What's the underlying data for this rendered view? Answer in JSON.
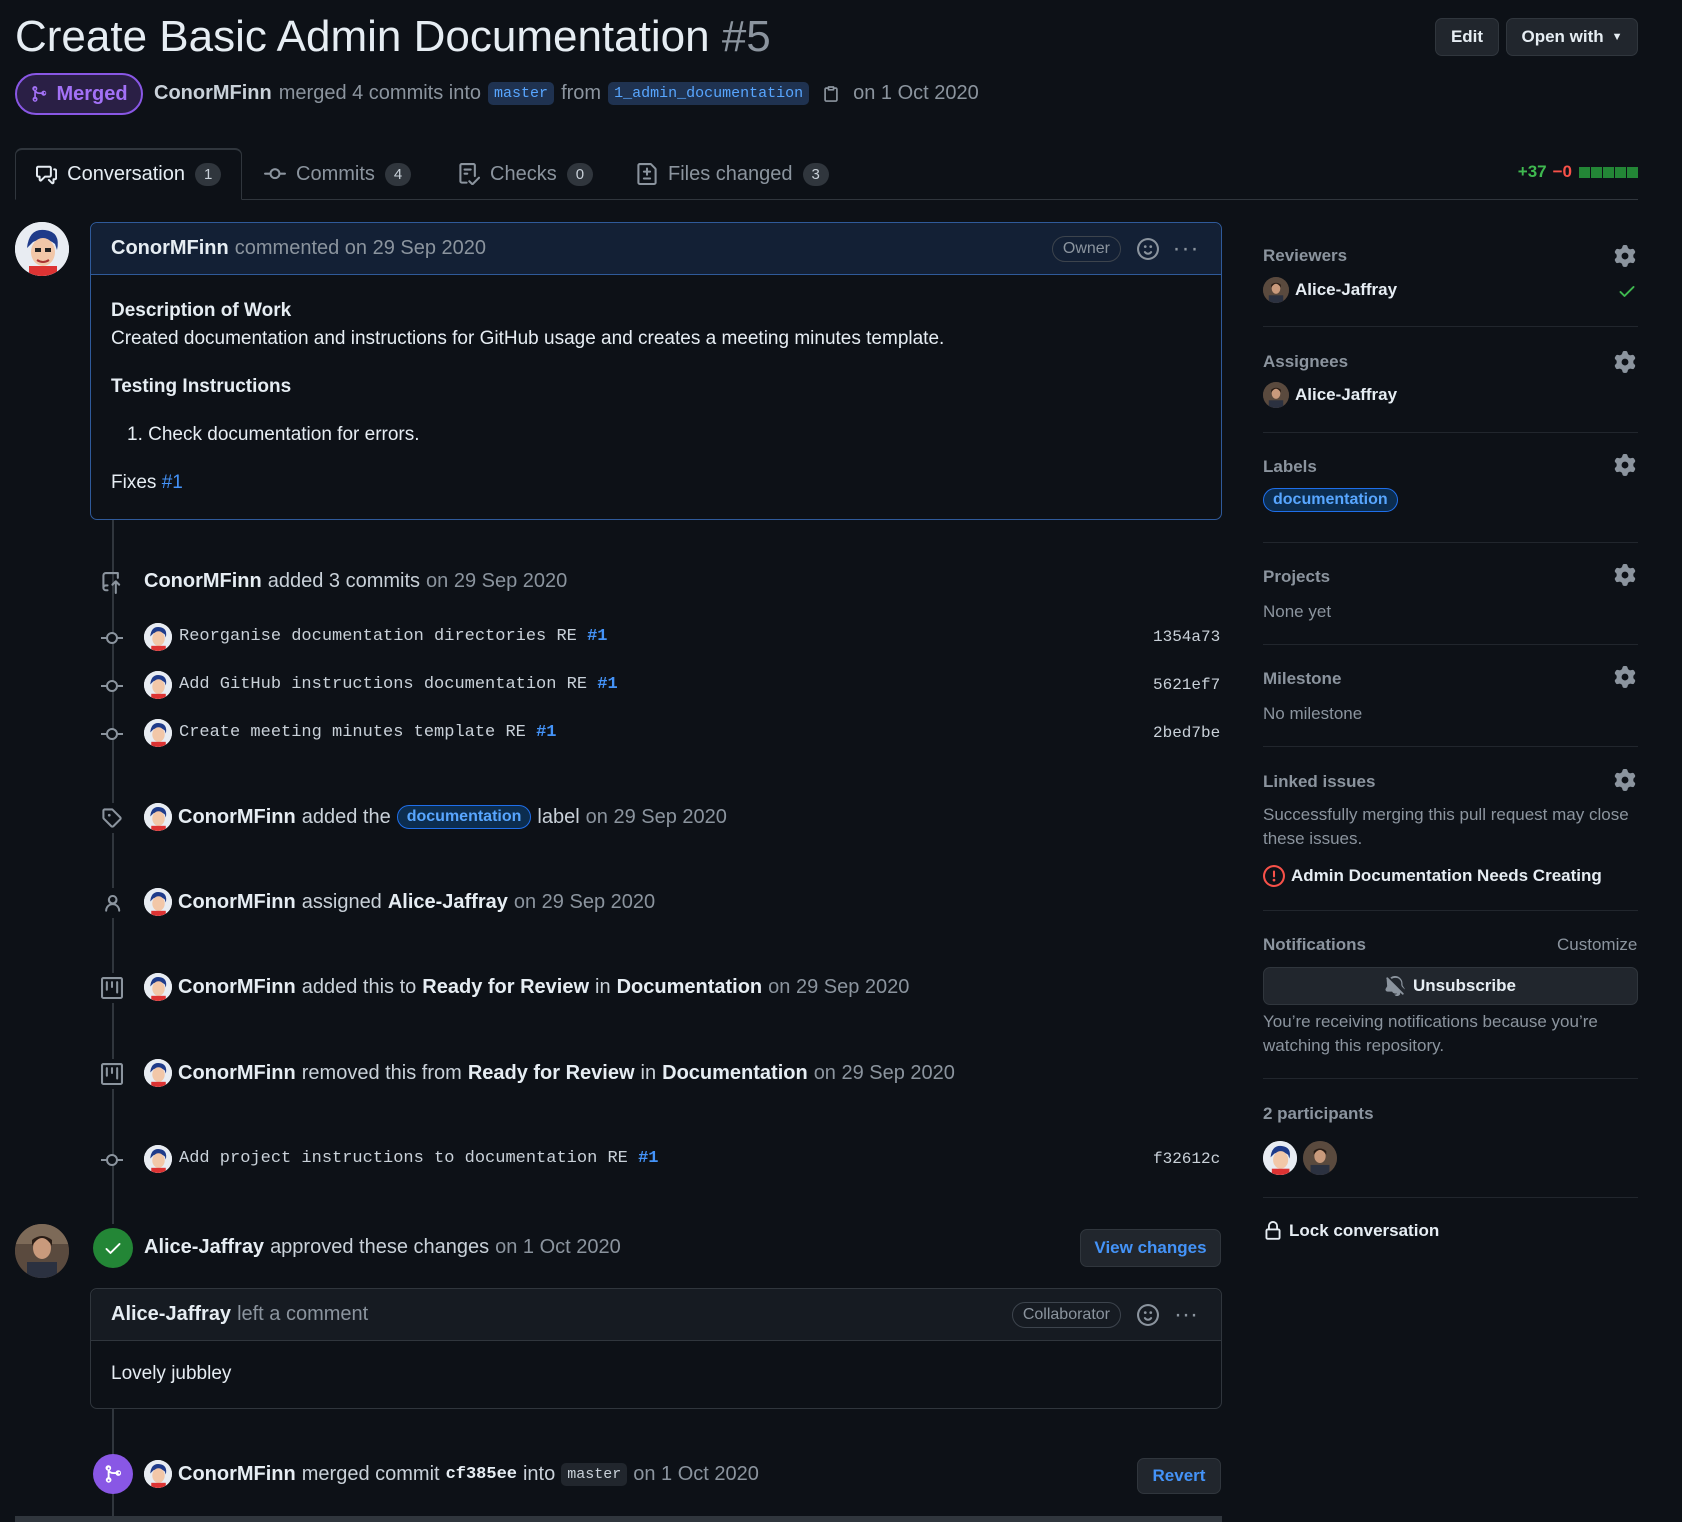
{
  "header": {
    "title": "Create Basic Admin Documentation",
    "number": "#5",
    "edit_label": "Edit",
    "open_with_label": "Open with",
    "state": "Merged",
    "author": "ConorMFinn",
    "merged_text": "merged 4 commits into",
    "base_branch": "master",
    "from_text": "from",
    "head_branch": "1_admin_documentation",
    "date_text": "on 1 Oct 2020"
  },
  "tabs": [
    {
      "label": "Conversation",
      "count": "1"
    },
    {
      "label": "Commits",
      "count": "4"
    },
    {
      "label": "Checks",
      "count": "0"
    },
    {
      "label": "Files changed",
      "count": "3"
    }
  ],
  "diffstat": {
    "additions": "+37",
    "deletions": "−0"
  },
  "first_comment": {
    "author": "ConorMFinn",
    "meta": "commented on 29 Sep 2020",
    "role": "Owner",
    "heading1": "Description of Work",
    "text1": "Created documentation and instructions for GitHub usage and creates a meeting minutes template.",
    "heading2": "Testing Instructions",
    "list_item": "Check documentation for errors.",
    "fixes_text": "Fixes",
    "fixes_ref": "#1"
  },
  "events": {
    "added_commits": {
      "user": "ConorMFinn",
      "text": "added 3 commits",
      "date": "on 29 Sep 2020"
    },
    "commits": [
      {
        "message": "Reorganise documentation directories RE",
        "ref": "#1",
        "sha": "1354a73"
      },
      {
        "message": "Add GitHub instructions documentation RE",
        "ref": "#1",
        "sha": "5621ef7"
      },
      {
        "message": "Create meeting minutes template RE",
        "ref": "#1",
        "sha": "2bed7be"
      }
    ],
    "label_event": {
      "user": "ConorMFinn",
      "pre": "added the",
      "label": "documentation",
      "post": "label",
      "date": "on 29 Sep 2020"
    },
    "assign_event": {
      "user": "ConorMFinn",
      "pre": "assigned",
      "assignee": "Alice-Jaffray",
      "date": "on 29 Sep 2020"
    },
    "project_add": {
      "user": "ConorMFinn",
      "pre": "added this to",
      "column": "Ready for Review",
      "in": "in",
      "project": "Documentation",
      "date": "on 29 Sep 2020"
    },
    "project_remove": {
      "user": "ConorMFinn",
      "pre": "removed this from",
      "column": "Ready for Review",
      "in": "in",
      "project": "Documentation",
      "date": "on 29 Sep 2020"
    },
    "late_commit": {
      "message": "Add project instructions to documentation RE",
      "ref": "#1",
      "sha": "f32612c"
    },
    "review": {
      "user": "Alice-Jaffray",
      "text": "approved these changes",
      "date": "on 1 Oct 2020",
      "button": "View changes"
    },
    "review_comment": {
      "author": "Alice-Jaffray",
      "meta": "left a comment",
      "role": "Collaborator",
      "body": "Lovely jubbley"
    },
    "merge": {
      "user": "ConorMFinn",
      "pre": "merged commit",
      "sha": "cf385ee",
      "into": "into",
      "branch": "master",
      "date": "on 1 Oct 2020",
      "button": "Revert"
    }
  },
  "sidebar": {
    "reviewers": {
      "title": "Reviewers",
      "user": "Alice-Jaffray"
    },
    "assignees": {
      "title": "Assignees",
      "user": "Alice-Jaffray"
    },
    "labels": {
      "title": "Labels",
      "label": "documentation"
    },
    "projects": {
      "title": "Projects",
      "value": "None yet"
    },
    "milestone": {
      "title": "Milestone",
      "value": "No milestone"
    },
    "linked": {
      "title": "Linked issues",
      "text": "Successfully merging this pull request may close these issues.",
      "issue": "Admin Documentation Needs Creating"
    },
    "notifications": {
      "title": "Notifications",
      "customize": "Customize",
      "button": "Unsubscribe",
      "text": "You’re receiving notifications because you’re watching this repository."
    },
    "participants": {
      "title": "2 participants"
    },
    "lock": "Lock conversation"
  },
  "colors": {
    "merged": "#8957e5",
    "accent": "#4493f8",
    "success": "#238636",
    "danger": "#f85149"
  }
}
